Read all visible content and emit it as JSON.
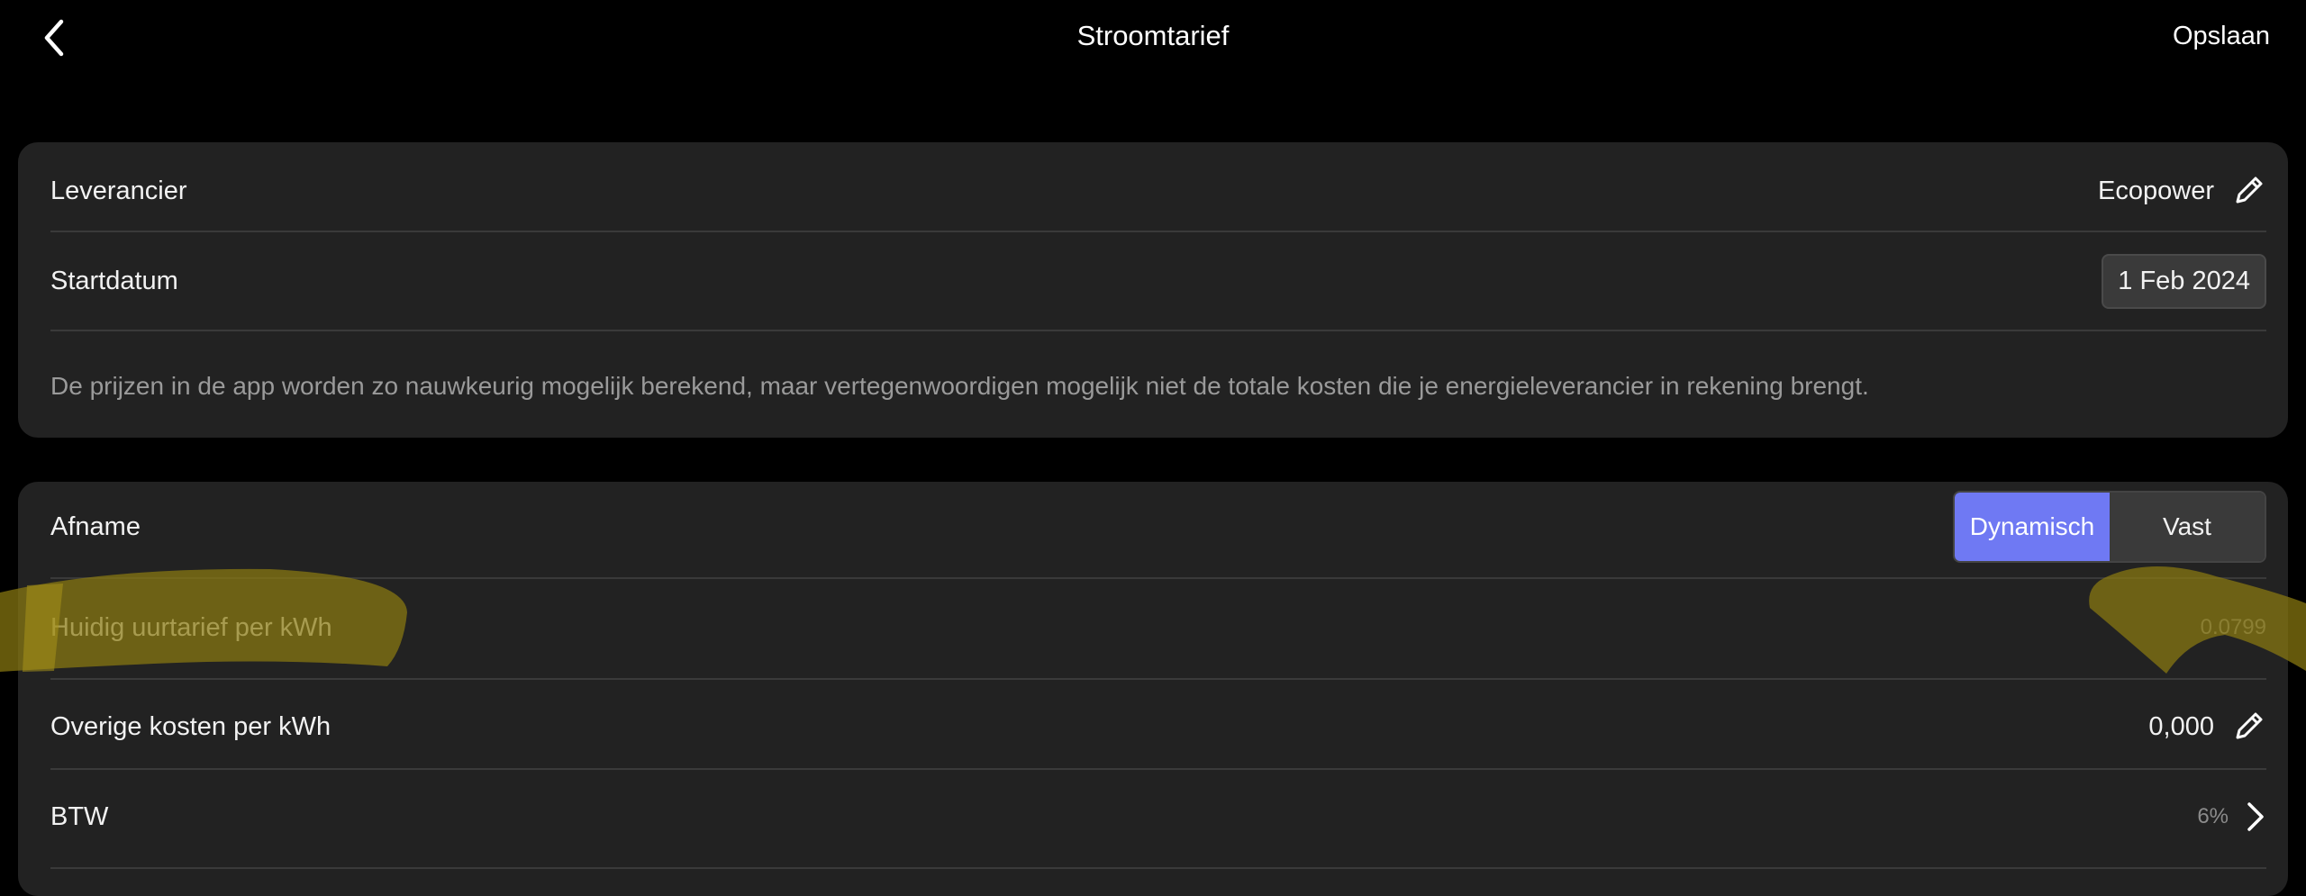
{
  "header": {
    "title": "Stroomtarief",
    "save_label": "Opslaan",
    "back_icon": "chevron-left-icon"
  },
  "supplier_card": {
    "supplier": {
      "label": "Leverancier",
      "value": "Ecopower",
      "edit_icon": "pencil-icon"
    },
    "start_date": {
      "label": "Startdatum",
      "value": "1 Feb 2024"
    },
    "disclaimer": "De prijzen in de app worden zo nauwkeurig mogelijk berekend, maar vertegenwoordigen mogelijk niet de totale kosten die je energieleverancier in rekening brengt."
  },
  "tariff_card": {
    "consumption": {
      "label": "Afname",
      "options": [
        "Dynamisch",
        "Vast"
      ],
      "selected": "Dynamisch"
    },
    "current_rate": {
      "label": "Huidig uurtarief per kWh",
      "value": "0.0799"
    },
    "other_costs": {
      "label": "Overige kosten per kWh",
      "value": "0,000",
      "edit_icon": "pencil-icon"
    },
    "vat": {
      "label": "BTW",
      "value": "6%",
      "chevron_icon": "chevron-right-icon"
    }
  },
  "colors": {
    "background": "#000000",
    "card": "#222222",
    "accent": "#6f79f3",
    "highlight": "#8a7a10",
    "muted_text": "#9a9a9a"
  }
}
